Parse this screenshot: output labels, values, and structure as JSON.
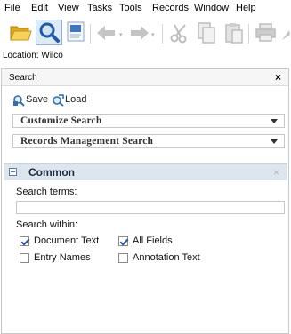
{
  "menu": [
    "File",
    "Edit",
    "View",
    "Tasks",
    "Tools",
    "Records",
    "Window",
    "Help"
  ],
  "location": {
    "label": "Location:",
    "value": "Wilco"
  },
  "panel": {
    "title": "Search",
    "close_glyph": "×",
    "actions": {
      "save": "Save",
      "load": "Load"
    },
    "dropdowns": {
      "customize": "Customize Search",
      "records": "Records Management Search"
    },
    "section": {
      "title": "Common",
      "close_glyph": "×",
      "search_terms_label": "Search terms:",
      "search_terms_value": "",
      "search_within_label": "Search within:",
      "options": [
        {
          "label": "Document Text",
          "checked": true
        },
        {
          "label": "All Fields",
          "checked": true
        },
        {
          "label": "Entry Names",
          "checked": false
        },
        {
          "label": "Annotation Text",
          "checked": false
        }
      ]
    }
  },
  "colors": {
    "section_bg": "#dde5ef",
    "icon_blue": "#2f6fb5",
    "folder_yellow": "#f2c744",
    "disabled_gray": "#b9b9b9"
  },
  "icons": [
    "folder-open-icon",
    "search-icon",
    "form-icon",
    "back-arrow-icon",
    "forward-arrow-icon",
    "cut-icon",
    "copy-icon",
    "paste-icon",
    "print-icon"
  ]
}
